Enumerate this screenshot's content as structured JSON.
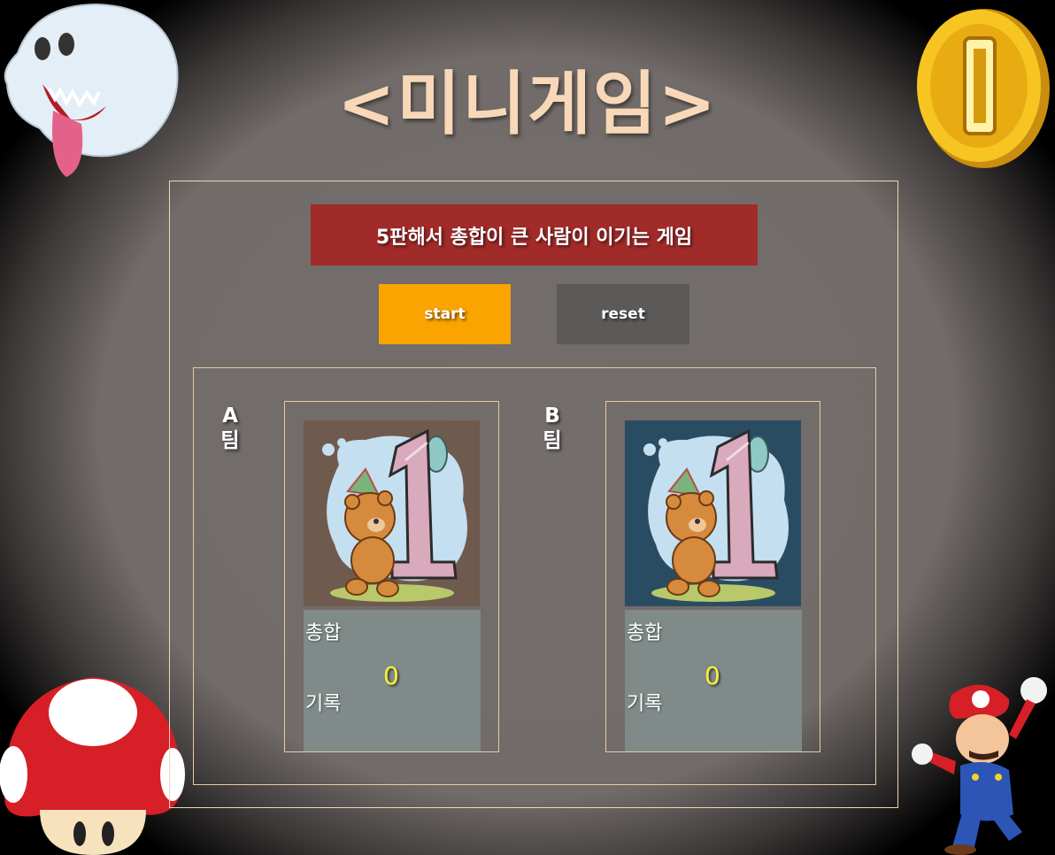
{
  "title": "<미니게임>",
  "rule": "5판해서 총합이 큰 사람이 이기는 게임",
  "buttons": {
    "start": "start",
    "reset": "reset"
  },
  "teams": [
    {
      "label": "A 팀",
      "label_top": "A",
      "label_bottom": "팀",
      "card_bg": "#6f5a4e",
      "sum_label": "총합",
      "record_label": "기록",
      "score": "0"
    },
    {
      "label": "B 팀",
      "label_top": "B",
      "label_bottom": "팀",
      "card_bg": "#2a4c63",
      "sum_label": "총합",
      "record_label": "기록",
      "score": "0"
    }
  ],
  "decorations": [
    "boo-ghost-icon",
    "gold-coin-icon",
    "mushroom-icon",
    "mario-icon"
  ],
  "colors": {
    "title": "#f8d8b8",
    "banner": "#a12b29",
    "start": "#fba400",
    "reset": "#5c5a59",
    "score": "#f7ef3a"
  }
}
